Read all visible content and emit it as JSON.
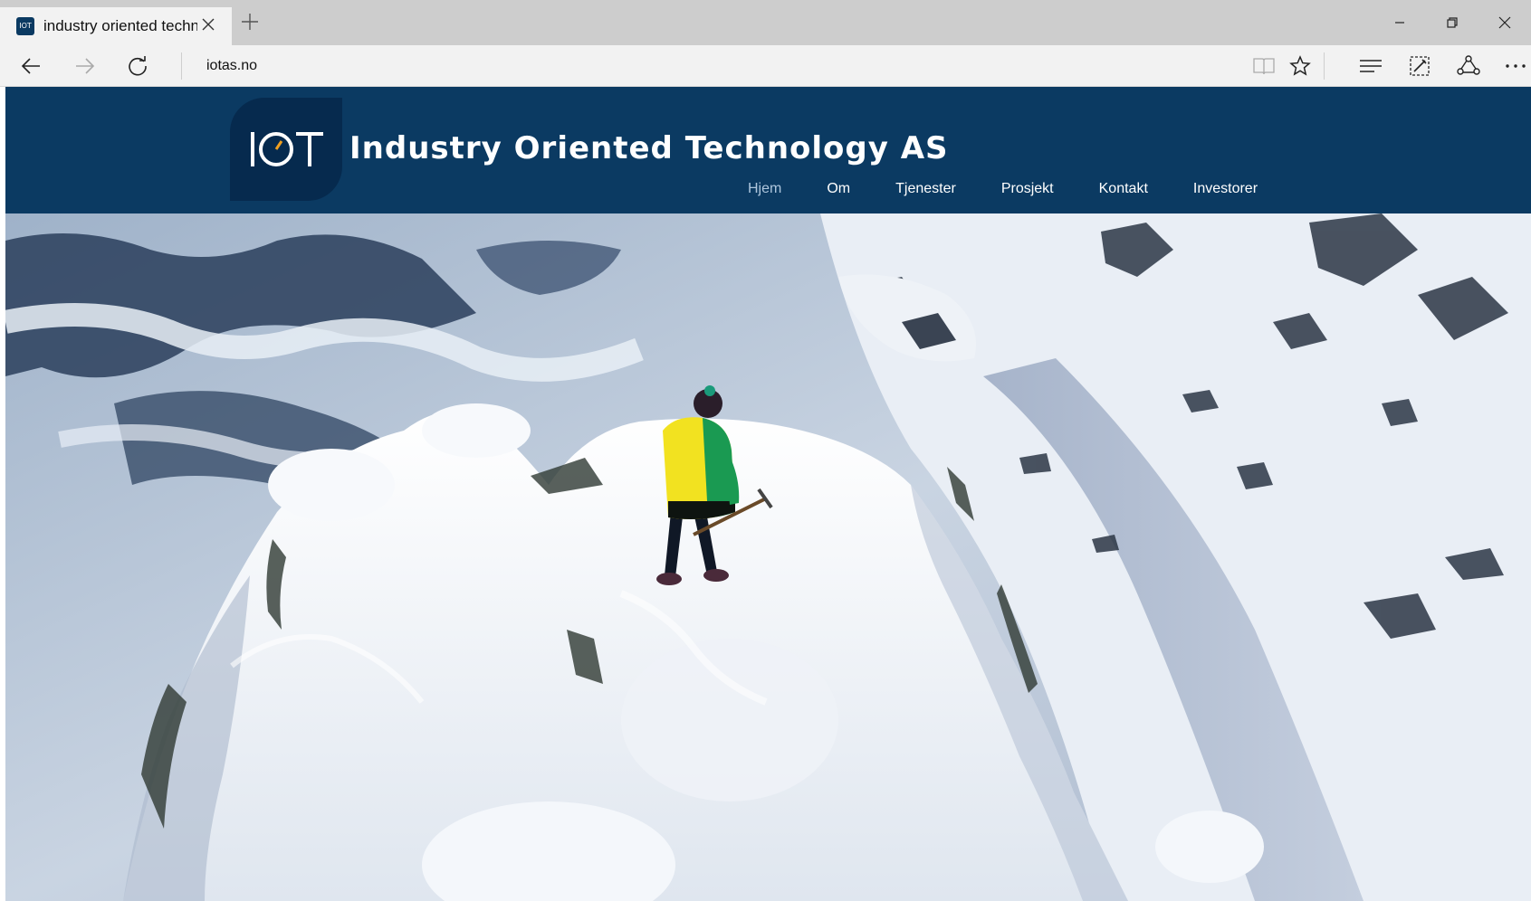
{
  "browser": {
    "tab": {
      "title": "industry oriented techn",
      "favicon_label": "IOT",
      "close_icon": "close-icon"
    },
    "new_tab_icon": "plus-icon",
    "window_controls": [
      "minimize-icon",
      "restore-icon",
      "close-icon"
    ],
    "address_bar": {
      "url": "iotas.no"
    },
    "toolbar_icons": [
      "reading-view-icon",
      "favorite-star-icon",
      "hub-icon",
      "web-note-icon",
      "share-icon",
      "more-icon"
    ]
  },
  "site": {
    "logo_text": "IOT",
    "title": "Industry Oriented Technology AS",
    "nav": [
      {
        "label": "Hjem",
        "active": true
      },
      {
        "label": "Om",
        "active": false
      },
      {
        "label": "Tjenester",
        "active": false
      },
      {
        "label": "Prosjekt",
        "active": false
      },
      {
        "label": "Kontakt",
        "active": false
      },
      {
        "label": "Investorer",
        "active": false
      }
    ],
    "colors": {
      "header_bg": "#0b3a62",
      "logo_bg": "#062a4e",
      "nav_active": "#aec6dd"
    }
  }
}
